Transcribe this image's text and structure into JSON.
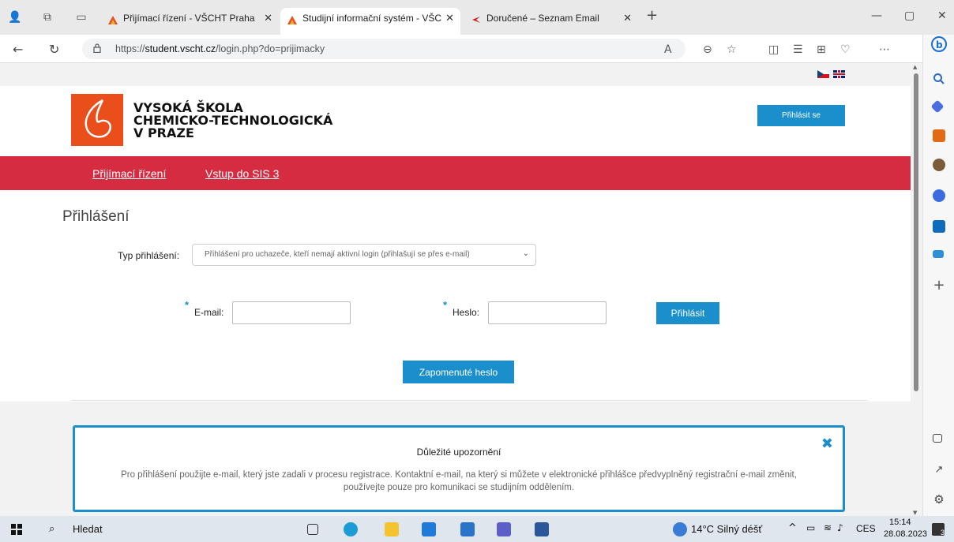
{
  "browser": {
    "tabs": [
      {
        "title": "Přijímací řízení - VŠCHT Praha",
        "active": false
      },
      {
        "title": "Studijní informační systém - VŠC",
        "active": true
      },
      {
        "title": "Doručené – Seznam Email",
        "active": false
      }
    ],
    "url_prefix": "https://",
    "url_host": "student.vscht.cz",
    "url_path": "/login.php?do=prijimacky",
    "new_tab": "+"
  },
  "page": {
    "school_line1": "VYSOKÁ ŠKOLA",
    "school_line2": "CHEMICKO-TECHNOLOGICKÁ",
    "school_line3": "V PRAZE",
    "login_top_label": "Přihlásit se",
    "nav": [
      "Přijímací řízení",
      "Vstup do SIS 3"
    ],
    "heading": "Přihlášení",
    "type_label": "Typ přihlášení:",
    "type_value": "Přihlášení pro uchazeče, kteří nemají aktivní login (přihlašují se přes e-mail)",
    "email_label": "E-mail:",
    "password_label": "Heslo:",
    "required_mark": "*",
    "submit_label": "Přihlásit",
    "forgot_label": "Zapomenuté heslo",
    "notice_title": "Důležité upozornění",
    "notice_text": "Pro přihlášení použijte e-mail, který jste zadali v procesu registrace. Kontaktní e-mail, na který si můžete v elektronické přihlášce předvyplněný registrační e-mail změnit, používejte pouze pro komunikaci se studijním oddělením.",
    "accent_color": "#1a8fcc",
    "brand_red": "#d52c41"
  },
  "taskbar": {
    "search": "Hledat",
    "weather": "14°C Silný déšť",
    "lang": "CES",
    "time": "15:14",
    "date": "28.08.2023",
    "notifications": "3"
  }
}
